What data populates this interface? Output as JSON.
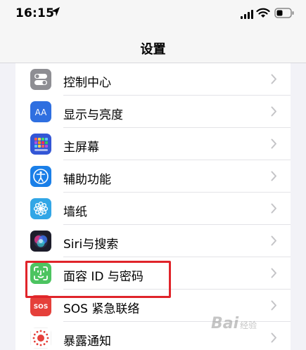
{
  "status_bar": {
    "time": "16:15"
  },
  "nav": {
    "title": "设置"
  },
  "settings": [
    {
      "label": "控制中心",
      "icon": "control-center-icon",
      "color": "#8e8e93"
    },
    {
      "label": "显示与亮度",
      "icon": "display-brightness-icon",
      "color": "#2f6fe0"
    },
    {
      "label": "主屏幕",
      "icon": "home-screen-icon",
      "color": "#3356d6"
    },
    {
      "label": "辅助功能",
      "icon": "accessibility-icon",
      "color": "#1a7fe8"
    },
    {
      "label": "墙纸",
      "icon": "wallpaper-icon",
      "color": "#32a6e6"
    },
    {
      "label": "Siri与搜索",
      "icon": "siri-icon",
      "color": "#1c1c2a"
    },
    {
      "label": "面容 ID 与密码",
      "icon": "face-id-icon",
      "color": "#4cc460"
    },
    {
      "label": "SOS 紧急联络",
      "icon": "sos-icon",
      "color": "#e5403a"
    },
    {
      "label": "暴露通知",
      "icon": "exposure-notification-icon",
      "color": "#ffffff"
    }
  ],
  "sos_icon_text": "SOS",
  "watermark": {
    "text": "Bai",
    "suffix": "经验"
  }
}
